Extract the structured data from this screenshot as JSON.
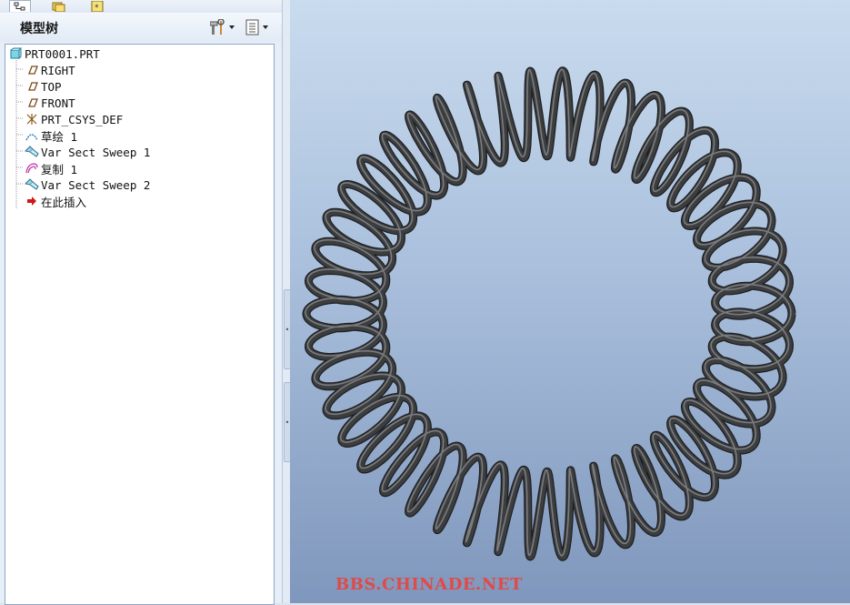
{
  "tabs": [
    {
      "name": "model-tree-tab",
      "icon": "model-tree-icon"
    },
    {
      "name": "folder-browser-tab",
      "icon": "folder-icon"
    },
    {
      "name": "favorites-tab",
      "icon": "favorites-icon"
    }
  ],
  "model_tree": {
    "title": "模型树",
    "settings_button_icon": "tools-icon",
    "show_button_icon": "list-icon",
    "items": [
      {
        "label": "PRT0001.PRT",
        "icon": "part-icon"
      },
      {
        "label": "RIGHT",
        "icon": "datum-plane-icon"
      },
      {
        "label": "TOP",
        "icon": "datum-plane-icon"
      },
      {
        "label": "FRONT",
        "icon": "datum-plane-icon"
      },
      {
        "label": "PRT_CSYS_DEF",
        "icon": "csys-icon"
      },
      {
        "label": "草绘 1",
        "icon": "sketch-icon"
      },
      {
        "label": "Var Sect Sweep 1",
        "icon": "sweep-icon"
      },
      {
        "label": "复制 1",
        "icon": "copy-icon"
      },
      {
        "label": "Var Sect Sweep 2",
        "icon": "sweep-icon"
      },
      {
        "label": "在此插入",
        "icon": "insert-here-arrow-icon"
      }
    ]
  },
  "viewport": {
    "model": "toroidal-coil-spring",
    "watermark": "BBS.CHINADE.NET"
  },
  "colors": {
    "viewport_top": "#c9dbee",
    "viewport_bottom": "#7f97bc",
    "coil": "#3c3d3f",
    "watermark": "#e04a4a"
  }
}
